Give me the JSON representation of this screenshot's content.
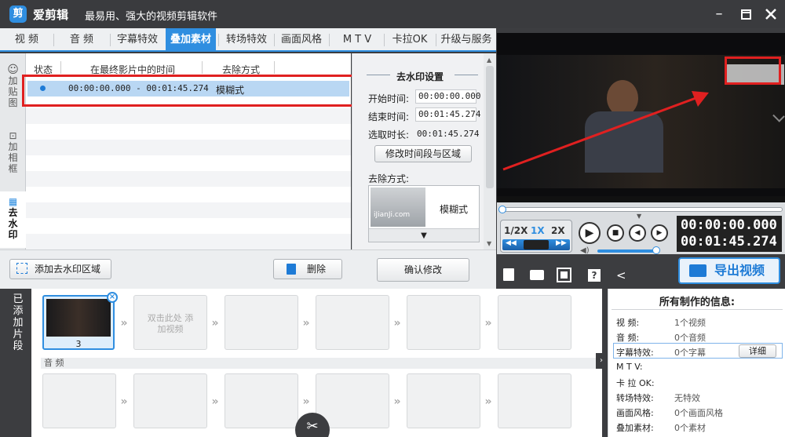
{
  "app": {
    "title": "爱剪辑",
    "subtitle": "最易用、强大的视频剪辑软件",
    "logo_text": "剪"
  },
  "tabs": [
    {
      "label": "视  频"
    },
    {
      "label": "音  频"
    },
    {
      "label": "字幕特效"
    },
    {
      "label": "叠加素材",
      "active": true
    },
    {
      "label": "转场特效"
    },
    {
      "label": "画面风格"
    },
    {
      "label": "M T V"
    },
    {
      "label": "卡拉OK"
    },
    {
      "label": "升级与服务"
    }
  ],
  "side_tabs": [
    {
      "label": "加贴图"
    },
    {
      "label": "加相框"
    },
    {
      "label": "去水印",
      "active": true
    }
  ],
  "table": {
    "headers": [
      "状态",
      "在最终影片中的时间",
      "去除方式"
    ],
    "rows": [
      {
        "time": "00:00:00.000 - 00:01:45.274",
        "mode": "模糊式"
      }
    ]
  },
  "settings": {
    "title": "去水印设置",
    "start_label": "开始时间:",
    "start_value": "00:00:00.000",
    "end_label": "结束时间:",
    "end_value": "00:01:45.274",
    "duration_label": "选取时长:",
    "duration_value": "00:01:45.274",
    "modify_button": "修改时间段与区域",
    "method_label": "去除方式:",
    "method_value": "模糊式",
    "method_thumb_text": "iJianJi.com",
    "confirm_button": "确认修改"
  },
  "actions": {
    "add_button": "添加去水印区域",
    "delete_button": "删除"
  },
  "player": {
    "speeds": [
      "1/2X",
      "1X",
      "2X"
    ],
    "time_current": "00:00:00.000",
    "time_total": "00:01:45.274"
  },
  "export_button": "导出视频",
  "clips": {
    "side_label": "已添加片段",
    "first_clip_index": "3",
    "hint": "双击此处 添加视频",
    "audio_label": "音 频"
  },
  "info": {
    "title": "所有制作的信息:",
    "detail_button": "详细",
    "items": [
      {
        "label": "视    频:",
        "value": "1个视频"
      },
      {
        "label": "音    频:",
        "value": "0个音频"
      },
      {
        "label": "字幕特效:",
        "value": "0个字幕"
      },
      {
        "label": "M  T  V:",
        "value": ""
      },
      {
        "label": "卡 拉 OK:",
        "value": ""
      },
      {
        "label": "转场特效:",
        "value": "无特效"
      },
      {
        "label": "画面风格:",
        "value": "0个画面风格"
      },
      {
        "label": "叠加素材:",
        "value": "0个素材"
      }
    ]
  },
  "colors": {
    "accent": "#2f8ee0",
    "highlight": "#e02020"
  }
}
